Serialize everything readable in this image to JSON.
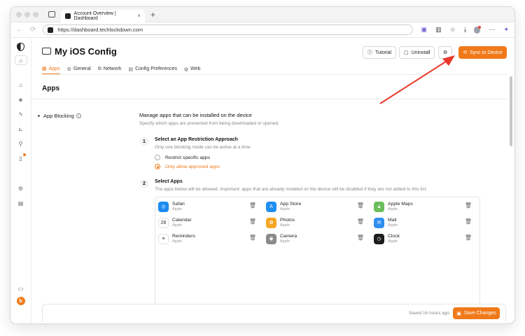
{
  "browser": {
    "tab_title": "Account Overview | Dashboard",
    "tab_close": "×",
    "new_tab": "+",
    "url": "https://dashboard.techlockdown.com"
  },
  "header": {
    "title": "My iOS Config",
    "tutorial_label": "Tutorial",
    "uninstall_label": "Uninstall",
    "sync_label": "Sync to Device"
  },
  "tabs": [
    {
      "label": "Apps",
      "active": true
    },
    {
      "label": "General"
    },
    {
      "label": "Network"
    },
    {
      "label": "Config Preferences"
    },
    {
      "label": "Web"
    }
  ],
  "section": {
    "title": "Apps",
    "row_label": "App Blocking"
  },
  "content": {
    "title": "Manage apps that can be installed on the device",
    "subtitle": "Specify which apps are prevented from being downloaded or opened.",
    "step1": {
      "num": "1",
      "title": "Select an App Restriction Approach",
      "sub": "Only one blocking mode can be active at a time",
      "options": [
        "Restrict specific apps",
        "Only allow approved apps"
      ],
      "selected": 1
    },
    "step2": {
      "num": "2",
      "title": "Select Apps",
      "sub": "The apps below will be allowed. Important: apps that are already installed on the device will be disabled if they are not added to this list."
    },
    "apps": [
      {
        "name": "Safari",
        "dev": "Apple",
        "icon": "safari-icon",
        "color": "#1a8cf0"
      },
      {
        "name": "App Store",
        "dev": "Apple",
        "icon": "app-store-icon",
        "color": "#1f8ef1"
      },
      {
        "name": "Apple Maps",
        "dev": "Apple",
        "icon": "maps-icon",
        "color": "#6cbf5b"
      },
      {
        "name": "Calendar",
        "dev": "Apple",
        "icon": "calendar-icon",
        "color": "#ffffff",
        "glyph": "28"
      },
      {
        "name": "Photos",
        "dev": "Apple",
        "icon": "photos-icon",
        "color": "#f5a623"
      },
      {
        "name": "Mail",
        "dev": "Apple",
        "icon": "mail-icon",
        "color": "#2f8ff0"
      },
      {
        "name": "Reminders",
        "dev": "Apple",
        "icon": "reminders-icon",
        "color": "#ffffff"
      },
      {
        "name": "Camera",
        "dev": "Apple",
        "icon": "camera-icon",
        "color": "#8a8a8a"
      },
      {
        "name": "Clock",
        "dev": "Apple",
        "icon": "clock-icon",
        "color": "#1c1c1c"
      }
    ]
  },
  "footer": {
    "saved_text": "Saved 16 hours ago",
    "save_label": "Save Changes"
  },
  "colors": {
    "accent": "#f07a1a",
    "annotation_arrow": "#e8382b"
  }
}
